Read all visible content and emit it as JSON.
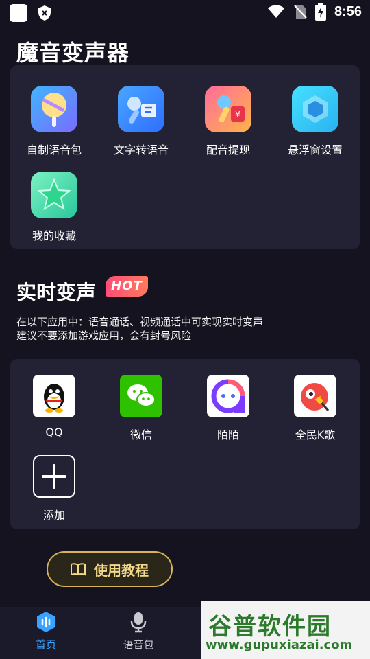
{
  "status": {
    "time": "8:56"
  },
  "main_title": "魔音变声器",
  "tools": [
    {
      "label": "自制语音包",
      "icon": "lollipop-icon"
    },
    {
      "label": "文字转语音",
      "icon": "mic-text-icon"
    },
    {
      "label": "配音提现",
      "icon": "mic-cash-icon"
    },
    {
      "label": "悬浮窗设置",
      "icon": "hexagon-icon"
    },
    {
      "label": "我的收藏",
      "icon": "star-icon"
    }
  ],
  "realtime": {
    "title": "实时变声",
    "badge": "HOT",
    "desc_line1": "在以下应用中：语音通话、视频通话中可实现实时变声",
    "desc_line2": "建议不要添加游戏应用，会有封号风险"
  },
  "apps": [
    {
      "label": "QQ",
      "icon": "qq-icon"
    },
    {
      "label": "微信",
      "icon": "wechat-icon"
    },
    {
      "label": "陌陌",
      "icon": "momo-icon"
    },
    {
      "label": "全民K歌",
      "icon": "kge-icon"
    },
    {
      "label": "添加",
      "icon": "plus-icon"
    }
  ],
  "tutorial_label": "使用教程",
  "tabs": [
    {
      "label": "首页",
      "active": true
    },
    {
      "label": "语音包",
      "active": false
    }
  ],
  "watermark": {
    "title": "谷普软件园",
    "url": "www.gupuxiazai.com"
  },
  "colors": {
    "accent": "#3aa3ff",
    "gold": "#d8b35a",
    "hot": "#ff4d7a"
  }
}
